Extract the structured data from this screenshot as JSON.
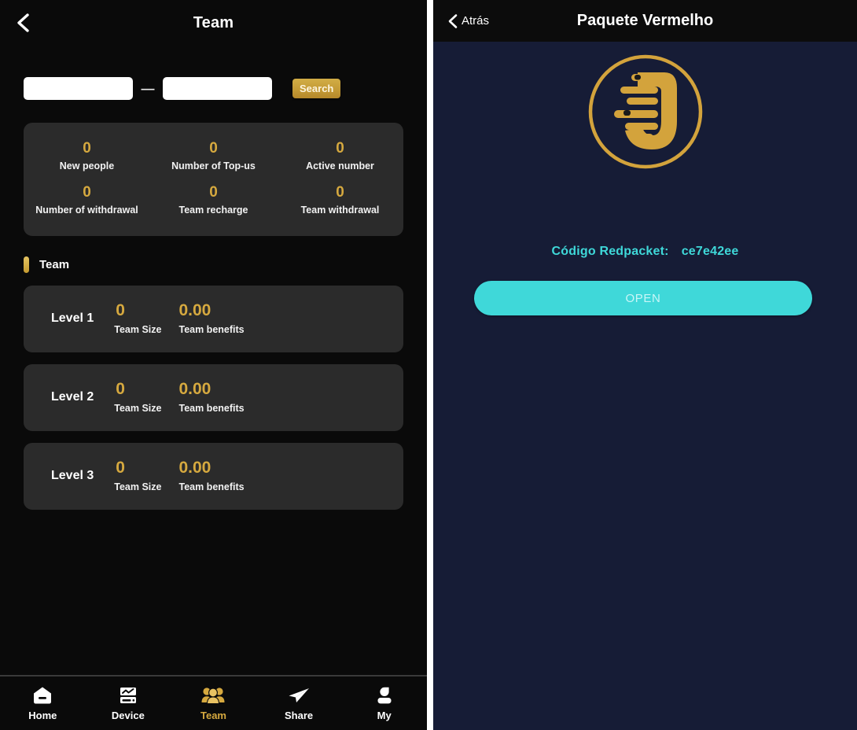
{
  "left": {
    "header": {
      "title": "Team",
      "back_icon": "chevron-left-icon"
    },
    "search": {
      "from_value": "",
      "from_placeholder": "",
      "to_value": "",
      "to_placeholder": "",
      "separator": "—",
      "button_label": "Search"
    },
    "stats": [
      {
        "value": "0",
        "label": "New people"
      },
      {
        "value": "0",
        "label": "Number of Top-us"
      },
      {
        "value": "0",
        "label": "Active number"
      },
      {
        "value": "0",
        "label": "Number of withdrawal"
      },
      {
        "value": "0",
        "label": "Team recharge"
      },
      {
        "value": "0",
        "label": "Team withdrawal"
      }
    ],
    "section": {
      "title": "Team"
    },
    "levels": [
      {
        "name": "Level 1",
        "size_value": "0",
        "size_label": "Team Size",
        "benefit_value": "0.00",
        "benefit_label": "Team benefits"
      },
      {
        "name": "Level 2",
        "size_value": "0",
        "size_label": "Team Size",
        "benefit_value": "0.00",
        "benefit_label": "Team benefits"
      },
      {
        "name": "Level 3",
        "size_value": "0",
        "size_label": "Team Size",
        "benefit_value": "0.00",
        "benefit_label": "Team benefits"
      }
    ],
    "nav": [
      {
        "label": "Home",
        "icon": "home-icon",
        "active": false
      },
      {
        "label": "Device",
        "icon": "device-monitor-icon",
        "active": false
      },
      {
        "label": "Team",
        "icon": "people-group-icon",
        "active": true
      },
      {
        "label": "Share",
        "icon": "paper-plane-icon",
        "active": false
      },
      {
        "label": "My",
        "icon": "user-profile-icon",
        "active": false
      }
    ]
  },
  "right": {
    "header": {
      "back_label": "Atrás",
      "back_icon": "chevron-left-icon",
      "title": "Paquete Vermelho"
    },
    "logo": {
      "name": "brand-u-logo"
    },
    "code": {
      "label": "Código Redpacket:",
      "value": "ce7e42ee"
    },
    "open_button": {
      "label": "OPEN"
    }
  },
  "colors": {
    "gold": "#d6a93f",
    "turquoise": "#3fd8d9",
    "left_bg": "#0a0a0a",
    "card_bg": "#2b2b2b",
    "right_bg": "#161c36"
  }
}
